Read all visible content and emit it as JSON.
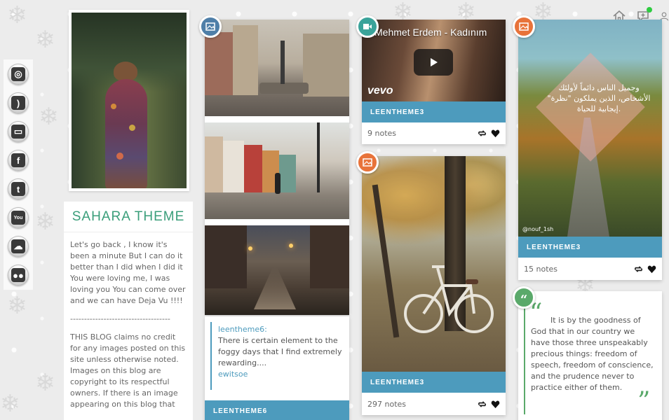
{
  "header_icons": [
    "home-icon",
    "add-post-icon",
    "account-icon"
  ],
  "social_links": [
    {
      "name": "instagram-icon",
      "glyph": "◎"
    },
    {
      "name": "rss-icon",
      "glyph": ")"
    },
    {
      "name": "monitor-icon",
      "glyph": "▭"
    },
    {
      "name": "facebook-icon",
      "glyph": "f"
    },
    {
      "name": "twitter-icon",
      "glyph": "t"
    },
    {
      "name": "youtube-icon",
      "glyph": "You"
    },
    {
      "name": "soundcloud-icon",
      "glyph": "☁"
    },
    {
      "name": "flickr-icon",
      "glyph": "●●"
    }
  ],
  "sidebar": {
    "title": "SAHARA THEME",
    "p1": "Let's go back , I know it's been a minute But I can do it better than I did when I did it You were loving me, I was loving you You can come over and we can have Deja Vu !!!!",
    "divider": "------------------------------------",
    "p2": "THIS BLOG claims no credit for any images posted on this site unless otherwise noted. Images on this blog are copyright to its respectful owners. If there is an image appearing on this blog that"
  },
  "posts": {
    "text_post": {
      "author": "leentheme6:",
      "body": "There is certain element to the foggy days that I find extremely rewarding....",
      "signature": "ewitsoe",
      "bar_label": "LEENTHEME6"
    },
    "video_post": {
      "video_title": "Mehmet Erdem - Kadınım",
      "brand": "vevo",
      "bar_label": "LEENTHEME3",
      "notes": "9 notes"
    },
    "bike_post": {
      "bar_label": "LEENTHEME3",
      "notes": "297 notes"
    },
    "road_post": {
      "arabic_text": "وجميل الناس دائماً لأولئك الأشخاص، الذين يملكون \"نظرة\" إيجابية للحياة.",
      "watermark": "@nouf_1sh",
      "bar_label": "LEENTHEME3",
      "notes": "15 notes"
    },
    "quote_post": {
      "text": "It is by the goodness of God that in our country we have those three unspeakably precious things: freedom of speech, freedom of conscience, and the prudence never to practice either of them."
    }
  },
  "colors": {
    "accent_blue": "#4d9bbd",
    "title_green": "#3a9e7a",
    "icon_photo_blue": "#4f7fa8",
    "icon_video_teal": "#3aa39a",
    "icon_orange": "#e8733a",
    "icon_quote_green": "#5aa96a"
  }
}
